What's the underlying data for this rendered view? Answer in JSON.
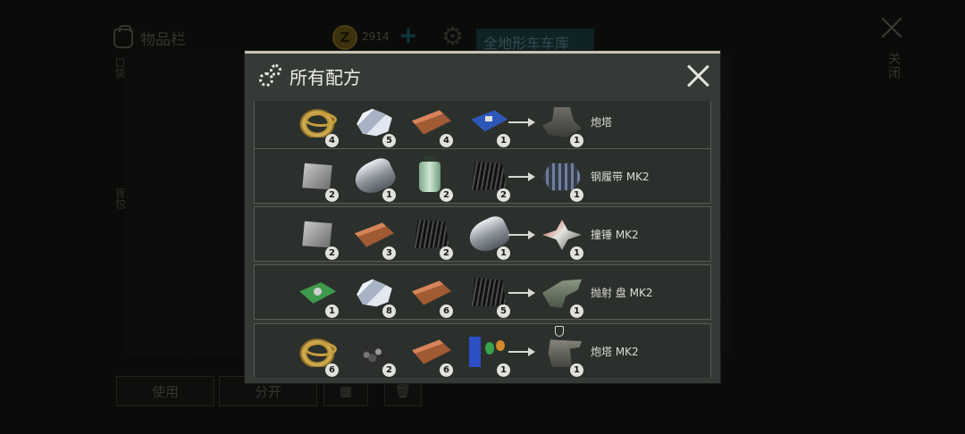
{
  "background": {
    "inventory_title": "物品栏",
    "coin_symbol": "Z",
    "coins": "2914",
    "garage_tab": "全地形车车库",
    "close_label": "关闭",
    "side_label_top": "口袋",
    "side_label_bottom": "背包",
    "use_button": "使用",
    "split_button": "分开"
  },
  "dialog": {
    "title": "所有配方",
    "recipes": [
      {
        "inputs": [
          {
            "icon": "leather-belt-icon",
            "qty": "4"
          },
          {
            "icon": "metal-crystal-icon",
            "qty": "5"
          },
          {
            "icon": "wood-board-icon",
            "qty": "4"
          },
          {
            "icon": "circuit-chip-icon",
            "qty": "1"
          }
        ],
        "output": {
          "icon": "turret-icon",
          "qty": "1",
          "name": "炮塔"
        }
      },
      {
        "inputs": [
          {
            "icon": "metal-plate-icon",
            "qty": "2"
          },
          {
            "icon": "metal-roll-icon",
            "qty": "1"
          },
          {
            "icon": "chemical-bottle-icon",
            "qty": "2"
          },
          {
            "icon": "carbon-sheet-icon",
            "qty": "2"
          }
        ],
        "output": {
          "icon": "steel-tread-icon",
          "qty": "1",
          "name": "钢履带 MK2"
        }
      },
      {
        "inputs": [
          {
            "icon": "metal-plate-icon",
            "qty": "2"
          },
          {
            "icon": "wood-board-icon",
            "qty": "3"
          },
          {
            "icon": "carbon-sheet-icon",
            "qty": "2"
          },
          {
            "icon": "metal-roll-icon",
            "qty": "1"
          }
        ],
        "output": {
          "icon": "ram-icon",
          "qty": "1",
          "name": "撞锤 MK2"
        }
      },
      {
        "inputs": [
          {
            "icon": "pcb-board-icon",
            "qty": "1"
          },
          {
            "icon": "metal-crystal-icon",
            "qty": "8"
          },
          {
            "icon": "wood-board-icon",
            "qty": "6"
          },
          {
            "icon": "carbon-sheet-icon",
            "qty": "5"
          }
        ],
        "output": {
          "icon": "launcher-icon",
          "qty": "1",
          "name": "抛射 盘 MK2"
        }
      },
      {
        "inputs": [
          {
            "icon": "leather-belt-icon",
            "qty": "6"
          },
          {
            "icon": "gravel-pile-icon",
            "qty": "2"
          },
          {
            "icon": "wood-board-icon",
            "qty": "6"
          },
          {
            "icon": "electronic-parts-icon",
            "qty": "1"
          }
        ],
        "output": {
          "icon": "turret-mk2-icon",
          "qty": "1",
          "name": "炮塔 MK2"
        }
      }
    ]
  }
}
